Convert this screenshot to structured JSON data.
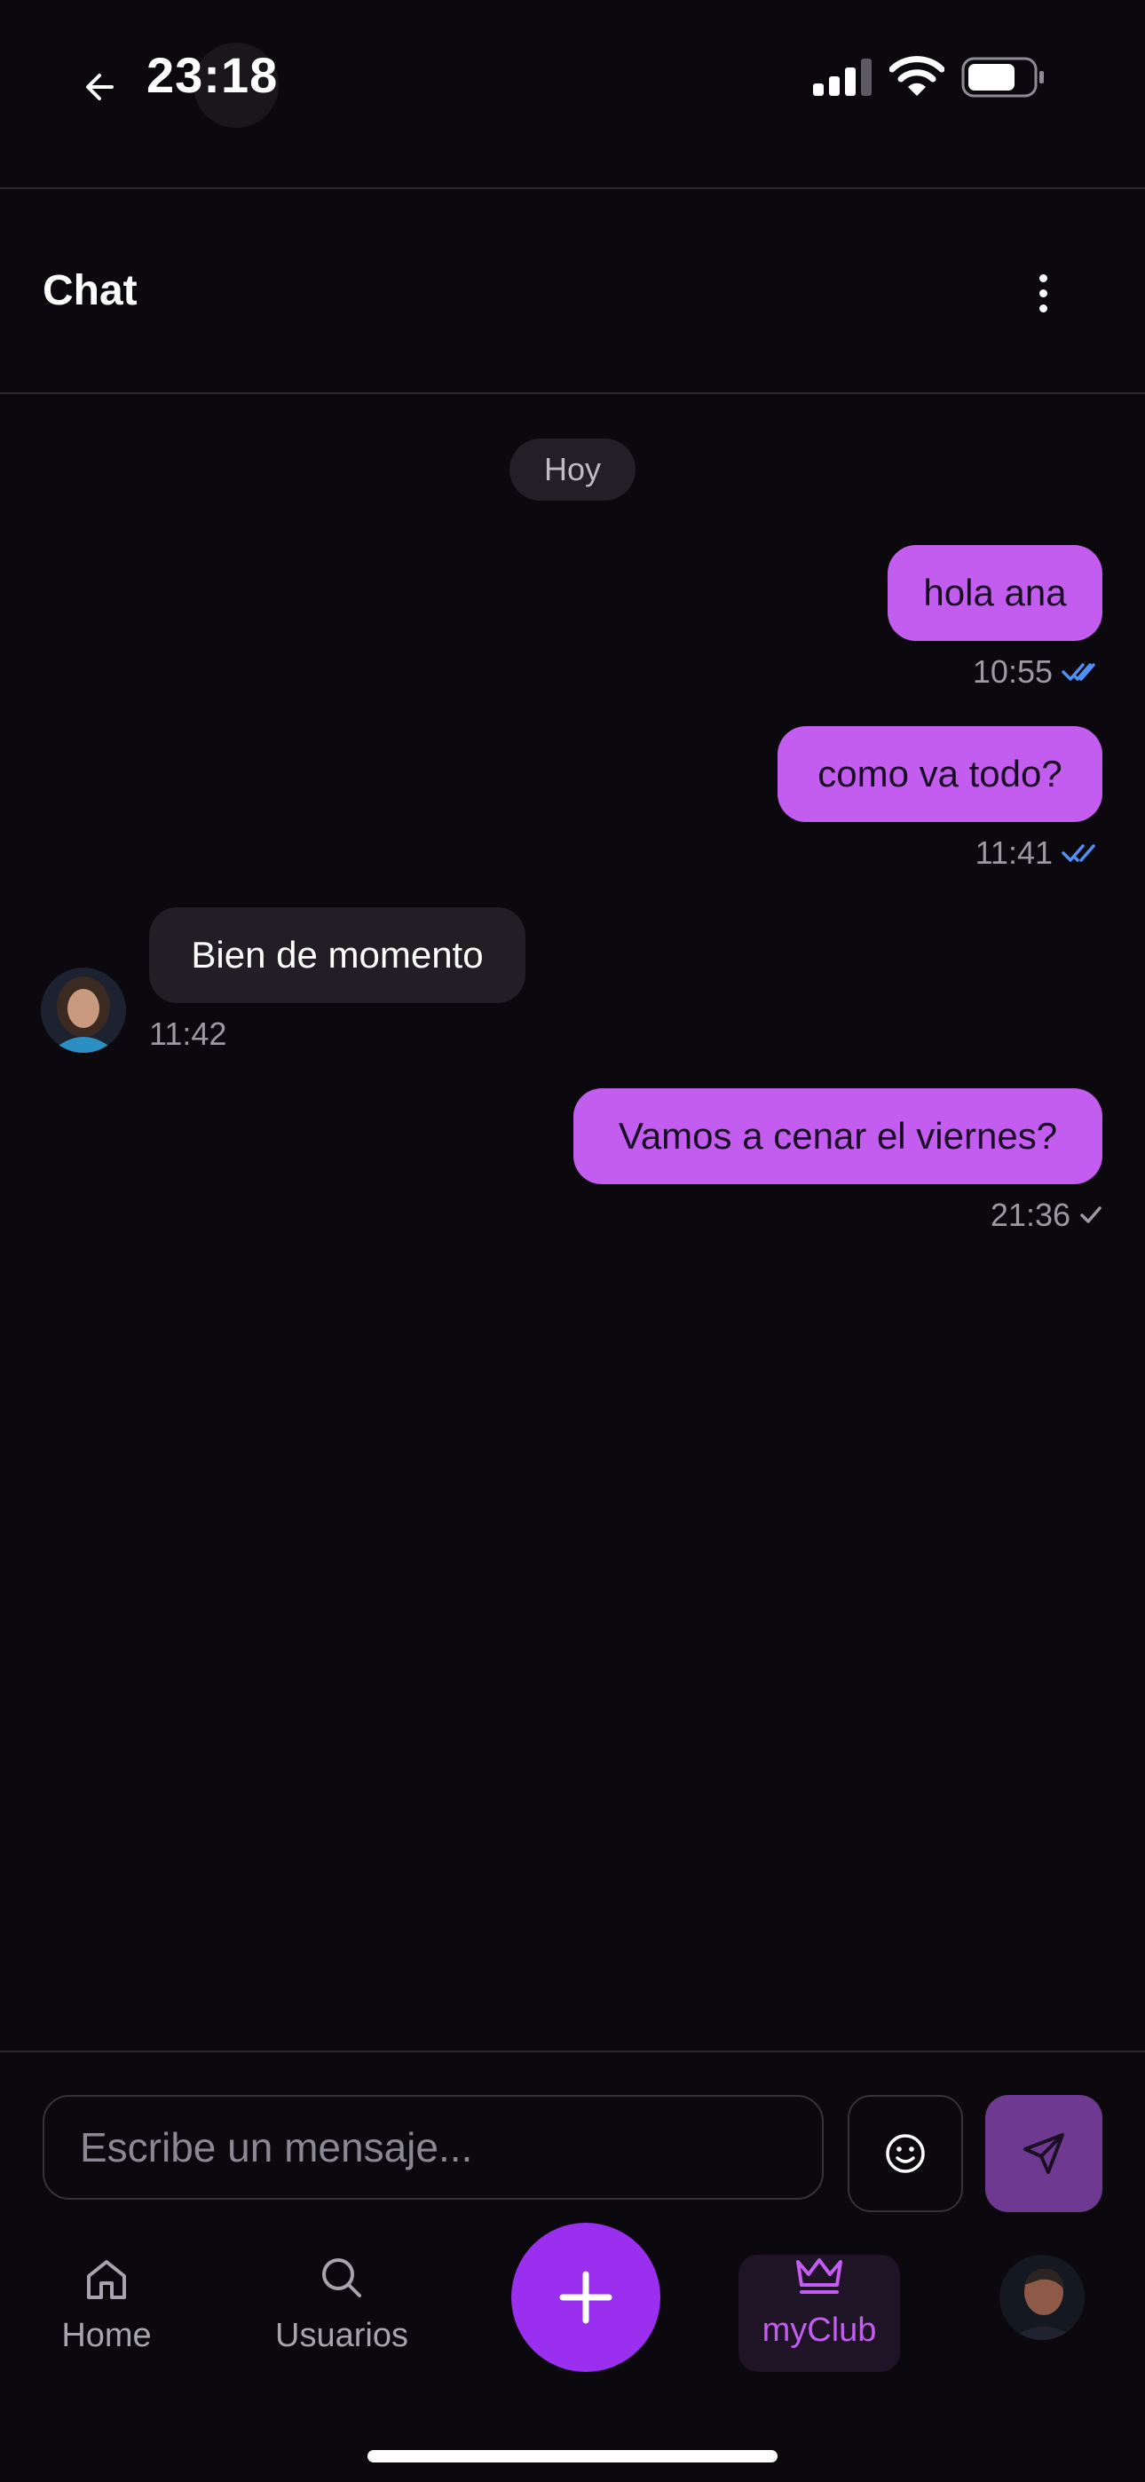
{
  "status_bar": {
    "time": "23:18",
    "icons": [
      "back-arrow-icon",
      "signal-icon",
      "wifi-icon",
      "battery-icon"
    ]
  },
  "header": {
    "title": "Chat",
    "menu_icon": "more-vertical-icon"
  },
  "date_divider": "Hoy",
  "messages": [
    {
      "direction": "outgoing",
      "text": "hola ana",
      "time": "10:55",
      "status": "read"
    },
    {
      "direction": "outgoing",
      "text": "como va todo?",
      "time": "11:41",
      "status": "read"
    },
    {
      "direction": "incoming",
      "text": "Bien de momento",
      "time": "11:42"
    },
    {
      "direction": "outgoing",
      "text": "Vamos a cenar el viernes?",
      "time": "21:36",
      "status": "sent"
    }
  ],
  "composer": {
    "placeholder": "Escribe un mensaje...",
    "emoji_icon": "smile-icon",
    "send_icon": "send-icon"
  },
  "tab_bar": {
    "items": [
      {
        "label": "Home",
        "icon": "home-icon"
      },
      {
        "label": "Usuarios",
        "icon": "search-icon"
      },
      {
        "label": "",
        "icon": "plus-icon"
      },
      {
        "label": "myClub",
        "icon": "crown-icon",
        "active": true
      },
      {
        "label": "",
        "icon": "profile-avatar"
      }
    ]
  },
  "colors": {
    "background": "#0b090d",
    "outgoing_bubble": "#c35df0",
    "incoming_bubble": "#211f25",
    "accent": "#9b2ff0",
    "read_check": "#4f8ff7"
  }
}
